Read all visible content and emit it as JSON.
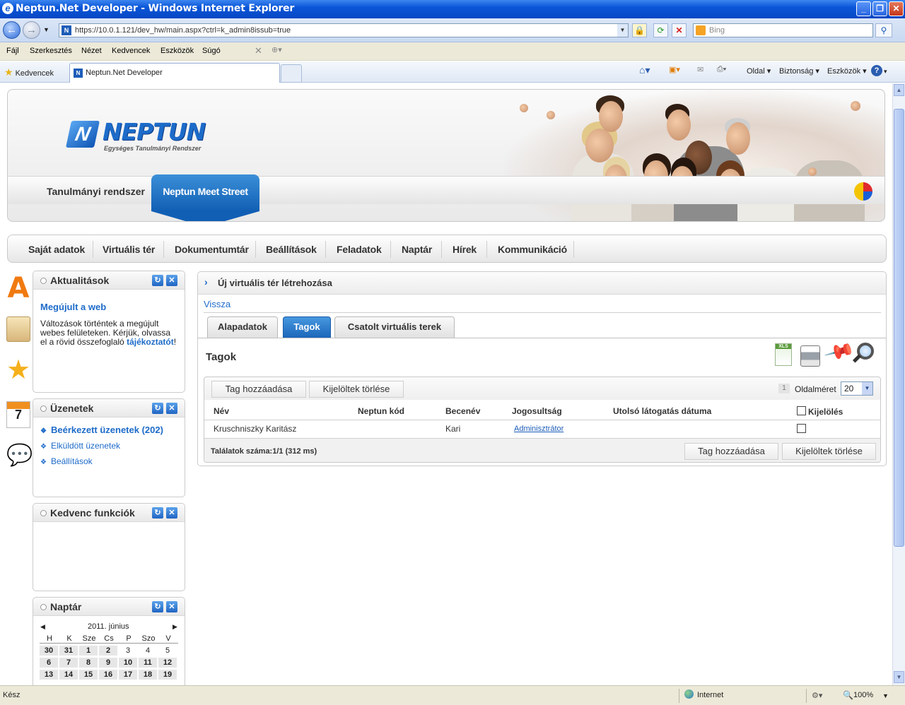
{
  "window": {
    "title": "Neptun.Net Developer - Windows Internet Explorer"
  },
  "address": {
    "url": "https://10.0.1.121/dev_hw/main.aspx?ctrl=k_admin8issub=true",
    "search_placeholder": "Bing"
  },
  "menu": [
    "Fájl",
    "Szerkesztés",
    "Nézet",
    "Kedvencek",
    "Eszközök",
    "Súgó"
  ],
  "favbar": {
    "favorites": "Kedvencek",
    "tab_title": "Neptun.Net Developer",
    "commands": [
      "Oldal",
      "Biztonság",
      "Eszközök"
    ]
  },
  "header": {
    "logo": "NEPTUN",
    "logo_sub": "Egységes Tanulmányi Rendszer",
    "tab1": "Tanulmányi rendszer",
    "tab2": "Neptun Meet Street"
  },
  "nav": [
    "Saját adatok",
    "Virtuális tér",
    "Dokumentumtár",
    "Beállítások",
    "Feladatok",
    "Naptár",
    "Hírek",
    "Kommunikáció"
  ],
  "sidebar": {
    "news": {
      "title": "Aktualitások",
      "headline": "Megújult a web",
      "body": "Változások történtek a megújult webes felületeken. Kérjük, olvassa el a rövid összefoglaló",
      "link": "tájékoztatót",
      "tail": "!"
    },
    "messages": {
      "title": "Üzenetek",
      "items": [
        "Beérkezett üzenetek (202)",
        "Elküldött üzenetek",
        "Beállítások"
      ]
    },
    "favorites": {
      "title": "Kedvenc funkciók"
    },
    "calendar": {
      "title": "Naptár",
      "month": "2011. június",
      "days": [
        "H",
        "K",
        "Sze",
        "Cs",
        "P",
        "Szo",
        "V"
      ],
      "weeks": [
        [
          "30",
          "31",
          "1",
          "2",
          "3",
          "4",
          "5"
        ],
        [
          "6",
          "7",
          "8",
          "9",
          "10",
          "11",
          "12"
        ],
        [
          "13",
          "14",
          "15",
          "16",
          "17",
          "18",
          "19"
        ]
      ]
    }
  },
  "content": {
    "title": "Új virtuális tér létrehozása",
    "back": "Vissza",
    "tabs": [
      "Alapadatok",
      "Tagok",
      "Csatolt virtuális terek"
    ],
    "section": "Tagok",
    "grid": {
      "add_button": "Tag hozzáadása",
      "delete_button": "Kijelöltek törlése",
      "page_num": "1",
      "page_size_label": "Oldalméret",
      "page_size": "20",
      "columns": [
        "Név",
        "Neptun kód",
        "Becenév",
        "Jogosultság",
        "Utolsó látogatás dátuma",
        "Kijelölés"
      ],
      "rows": [
        {
          "name": "Kruschniszky Karitász",
          "code": "",
          "nick": "Kari",
          "role": "Adminisztrátor",
          "last_visit": ""
        }
      ],
      "footer": "Találatok száma:1/1 (312 ms)",
      "footer_add": "Tag hozzáadása",
      "footer_delete": "Kijelöltek törlése"
    }
  },
  "status": {
    "left": "Kész",
    "zone": "Internet",
    "zoom": "100%"
  }
}
